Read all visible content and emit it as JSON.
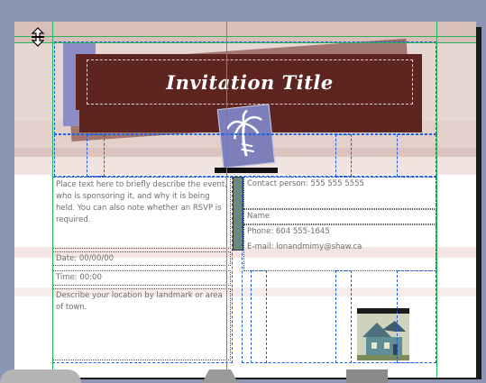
{
  "invitation": {
    "title": "Invitation Title",
    "description": "Place text here to briefly describe the event, who is sponsoring it, and why it is being held. You can also note whether an RSVP is required.",
    "date": "Date: 00/00/00",
    "time": "Time: 00:00",
    "location": "Describe your location by landmark or area of town."
  },
  "contact": {
    "person": "Contact person: 555 555 5555",
    "name": "Name",
    "phone": "Phone: 604 555-1645",
    "email": "E-mail: lonandmimy@shaw.ca"
  },
  "icons": {
    "cursor": "resize-vertical-cursor-icon",
    "palm": "palm-tree-icon",
    "house": "house-picture-icon"
  },
  "colors": {
    "title_background": "#5e2420",
    "frame_guides": "#1d5fe0",
    "margin_guides": "#27b35a",
    "pasteboard": "#8c95b4"
  }
}
